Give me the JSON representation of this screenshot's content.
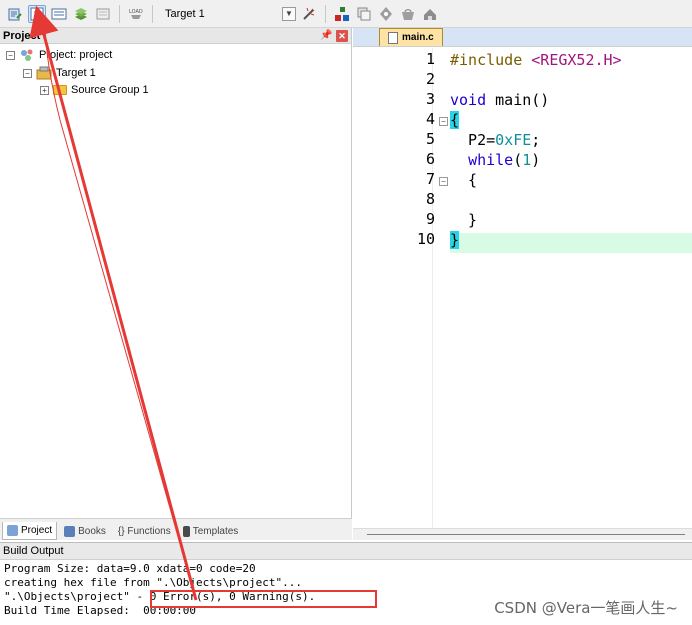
{
  "toolbar": {
    "target_label": "Target 1",
    "icons": [
      "translate-icon",
      "build-icon",
      "rebuild-icon",
      "batch-build-icon",
      "stop-build-icon",
      "download-icon",
      "target-options-icon",
      "manage-components-icon",
      "select-packs-icon",
      "pack-installer-icon",
      "gear-icon",
      "books-icon"
    ]
  },
  "project": {
    "title": "Project",
    "tree": {
      "root": "Project: project",
      "target": "Target 1",
      "group": "Source Group 1"
    },
    "tabs": [
      {
        "label": "Project",
        "active": true
      },
      {
        "label": "Books",
        "active": false
      },
      {
        "label": "{} Functions",
        "active": false
      },
      {
        "label": "Templates",
        "active": false
      }
    ]
  },
  "editor": {
    "tab": "main.c",
    "line_numbers": [
      "1",
      "2",
      "3",
      "4",
      "5",
      "6",
      "7",
      "8",
      "9",
      "10"
    ],
    "lines": [
      {
        "t": "#include <REGX52.H>"
      },
      {
        "t": ""
      },
      {
        "t": "void main()"
      },
      {
        "t": "{"
      },
      {
        "t": "  P2=0xFE;"
      },
      {
        "t": "  while(1)"
      },
      {
        "t": "  {"
      },
      {
        "t": ""
      },
      {
        "t": "  }"
      },
      {
        "t": "}"
      }
    ]
  },
  "build": {
    "title": "Build Output",
    "lines": [
      "Program Size: data=9.0 xdata=0 code=20",
      "creating hex file from \".\\Objects\\project\"...",
      "\".\\Objects\\project\" - 0 Error(s), 0 Warning(s).",
      "Build Time Elapsed:  00:00:00"
    ],
    "highlight": "0 Error(s), 0 Warning(s).",
    "watermark": "CSDN @Vera一笔画人生~"
  },
  "colors": {
    "annotation": "#e53935",
    "keyword": "#1c00cf",
    "number": "#0f8f9c",
    "include": "#a1147f",
    "line_highlight": "#d7fbe5",
    "brace_match": "#29d3e6",
    "tab_active": "#fde3a6"
  }
}
